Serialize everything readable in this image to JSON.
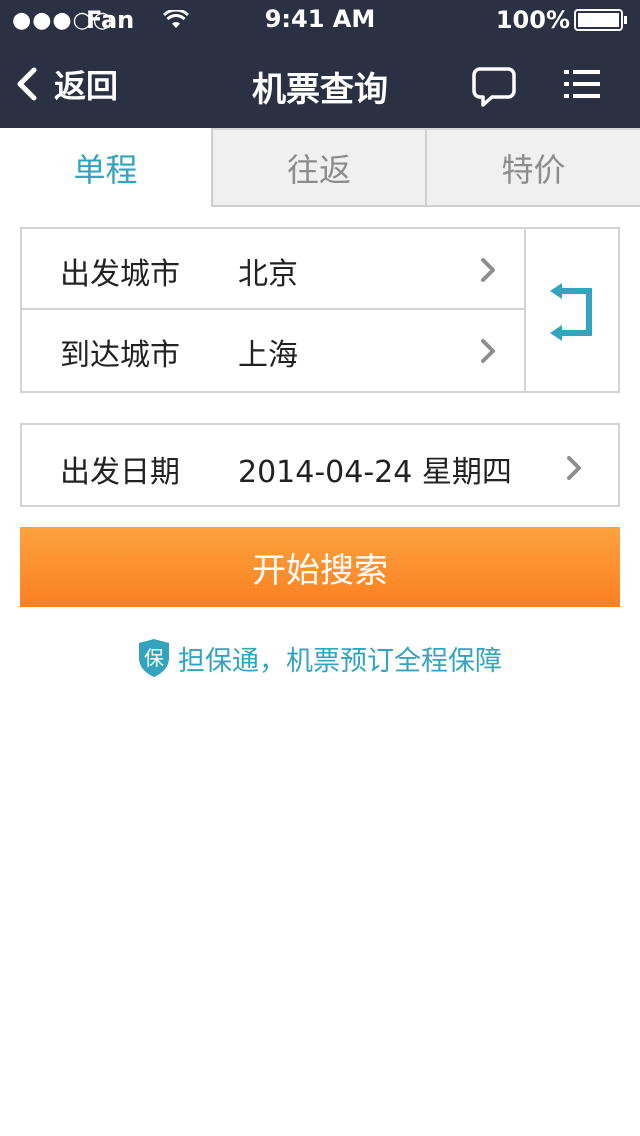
{
  "status_bar": {
    "signal": "●●●○○",
    "carrier": "Fan",
    "time": "9:41 AM",
    "battery": "100%"
  },
  "nav": {
    "back_label": "返回",
    "title": "机票查询",
    "icons": [
      "chevron-left-icon",
      "chat-bubble-icon",
      "list-menu-icon"
    ]
  },
  "tabs": [
    {
      "label": "单程",
      "active": true
    },
    {
      "label": "往返",
      "active": false
    },
    {
      "label": "特价",
      "active": false
    }
  ],
  "cities": {
    "departure": {
      "label": "出发城市",
      "value": "北京"
    },
    "arrival": {
      "label": "到达城市",
      "value": "上海"
    },
    "swap_icon": "swap-arrows-icon"
  },
  "date": {
    "label": "出发日期",
    "value": "2014-04-24 星期四"
  },
  "search_button": "开始搜索",
  "guarantee": {
    "badge": "保",
    "text": "担保通，机票预订全程保障"
  },
  "colors": {
    "header_bg": "#2a3143",
    "accent_teal": "#34a3bd",
    "button_orange": "#fb8b2a",
    "border": "#d3d3d3"
  }
}
